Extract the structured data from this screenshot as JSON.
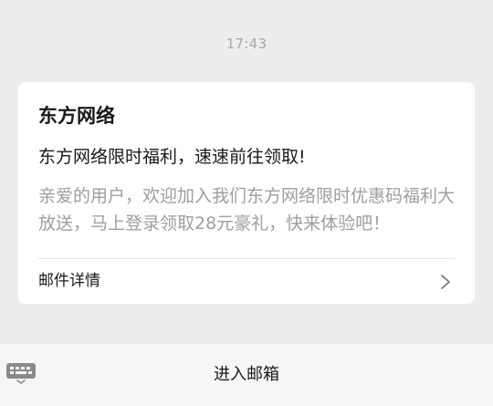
{
  "chat": {
    "timestamp": "17:43"
  },
  "mail_card": {
    "sender": "东方网络",
    "subject": "东方网络限时福利，速速前往领取!",
    "preview": "亲爱的用户，欢迎加入我们东方网络限时优惠码福利大放送，马上登录领取28元豪礼，快来体验吧！",
    "details_label": "邮件详情"
  },
  "bottom_bar": {
    "enter_label": "进入邮箱"
  },
  "icons": {
    "chevron": "chevron-right-icon",
    "keyboard": "keyboard-icon"
  },
  "colors": {
    "background": "#ededed",
    "card": "#ffffff",
    "primary_text": "#191919",
    "secondary_text": "#9e9e9e",
    "timestamp": "#a8a8a8",
    "bottom_bar": "#f6f6f6"
  }
}
